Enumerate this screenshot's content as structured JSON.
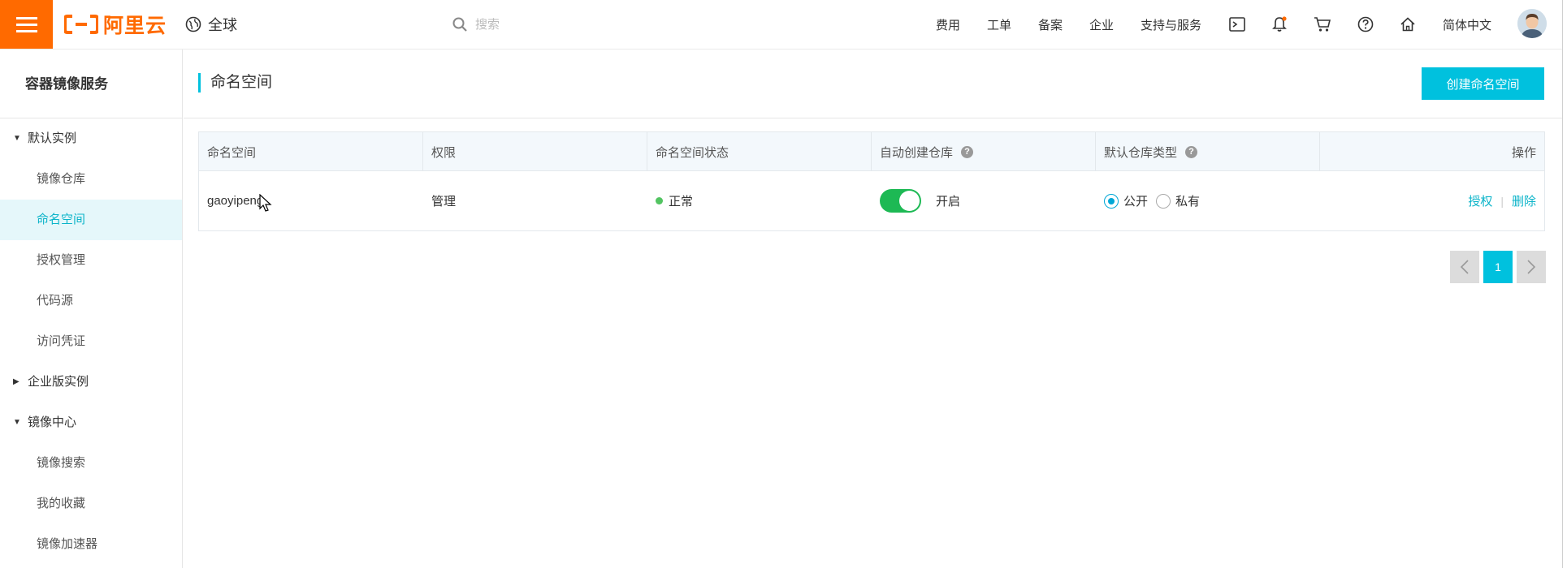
{
  "topbar": {
    "logo_text": "阿里云",
    "region": "全球",
    "search_placeholder": "搜索",
    "nav": [
      "费用",
      "工单",
      "备案",
      "企业",
      "支持与服务"
    ],
    "language": "简体中文",
    "accent_color": "#ff6a00"
  },
  "sidebar": {
    "title": "容器镜像服务",
    "groups": [
      {
        "label": "默认实例",
        "expanded": true,
        "items": [
          "镜像仓库",
          "命名空间",
          "授权管理",
          "代码源",
          "访问凭证"
        ]
      },
      {
        "label": "企业版实例",
        "expanded": false,
        "items": []
      },
      {
        "label": "镜像中心",
        "expanded": true,
        "items": [
          "镜像搜索",
          "我的收藏",
          "镜像加速器"
        ]
      }
    ],
    "active_item": "命名空间"
  },
  "header": {
    "title": "命名空间",
    "create_button": "创建命名空间",
    "button_color": "#00c1de"
  },
  "table": {
    "columns": [
      "命名空间",
      "权限",
      "命名空间状态",
      "自动创建仓库",
      "默认仓库类型",
      "操作"
    ],
    "rows": [
      {
        "namespace": "gaoyipeng",
        "permission": "管理",
        "status": "正常",
        "auto_create_enabled": true,
        "auto_create_label": "开启",
        "repo_type_options": [
          "公开",
          "私有"
        ],
        "repo_type_selected": "公开",
        "actions": [
          "授权",
          "删除"
        ]
      }
    ]
  },
  "pagination": {
    "current_page": "1"
  }
}
